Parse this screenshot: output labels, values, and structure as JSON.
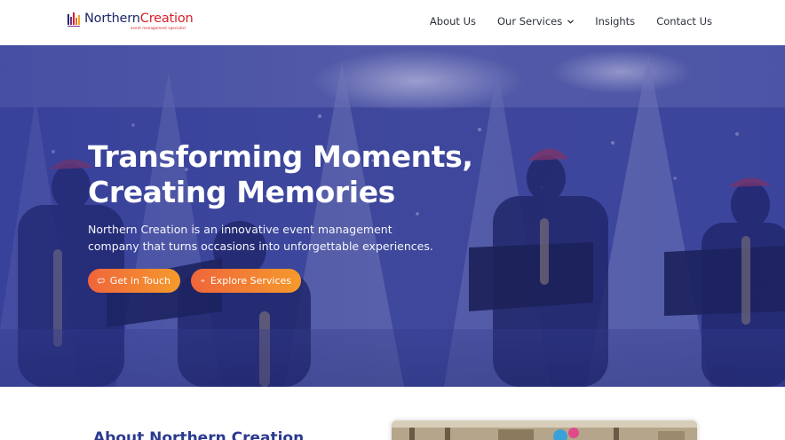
{
  "header": {
    "logo_name_part1": "Northern",
    "logo_name_part2": "Creation",
    "logo_tagline": "event management specialist",
    "nav": [
      {
        "label": "About Us"
      },
      {
        "label": "Our Services"
      },
      {
        "label": "Insights"
      },
      {
        "label": "Contact Us"
      }
    ]
  },
  "hero": {
    "title_line1": "Transforming Moments,",
    "title_line2": "Creating Memories",
    "subtitle_line1": "Northern Creation is an innovative event management",
    "subtitle_line2": "company that turns occasions into unforgettable experiences.",
    "buttons": {
      "touch": "Get in Touch",
      "explore": "Explore Services"
    }
  },
  "about": {
    "title": "About Northern Creation"
  },
  "colors": {
    "brand_navy": "#1e2a6b",
    "brand_red": "#d81f2a",
    "hero_overlay": "#2d3994",
    "button_start": "#f0653b",
    "button_end": "#f59a2c",
    "section_title": "#2b3a8f"
  },
  "icons": {
    "nav_dropdown": "chevron-down-icon",
    "touch_button": "chat-icon",
    "explore_button": "eye-icon"
  }
}
